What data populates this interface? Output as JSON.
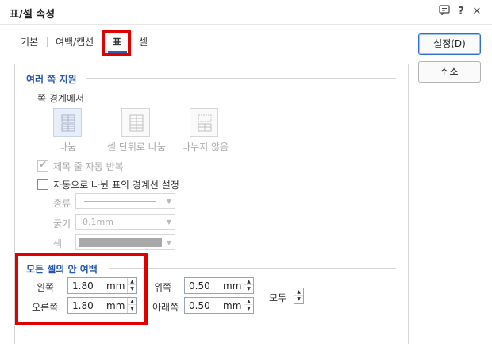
{
  "window": {
    "title": "표/셀 속성",
    "comment_icon": "comment-icon",
    "help_label": "?",
    "close_label": "✕"
  },
  "tabs": [
    {
      "label": "기본"
    },
    {
      "label": "여백/캡션"
    },
    {
      "label": "표",
      "active": true
    },
    {
      "label": "셀"
    }
  ],
  "buttons": {
    "ok": "설정(D)",
    "cancel": "취소"
  },
  "split_section": {
    "title": "여러 쪽 지원",
    "subtitle": "쪽 경계에서",
    "options": [
      {
        "label": "나눔",
        "selected": true,
        "icon": "split-table-icon"
      },
      {
        "label": "셀 단위로 나눔",
        "icon": "split-by-cell-icon"
      },
      {
        "label": "나누지 않음",
        "icon": "no-split-icon"
      }
    ],
    "repeat_title": {
      "label": "제목 줄 자동 반복",
      "checked": true,
      "disabled": true
    },
    "auto_border": {
      "label": "자동으로 나뉜 표의 경계선 설정",
      "checked": false
    }
  },
  "border_settings": {
    "type_label": "종류",
    "thickness_label": "굵기",
    "thickness_value": "0.1mm",
    "color_label": "색",
    "color_value": "#a9a9a9"
  },
  "margin_section": {
    "title": "모든 셀의 안 여백",
    "left": {
      "label": "왼쪽",
      "value": "1.80",
      "unit": "mm"
    },
    "right": {
      "label": "오른쪽",
      "value": "1.80",
      "unit": "mm"
    },
    "top": {
      "label": "위쪽",
      "value": "0.50",
      "unit": "mm"
    },
    "bottom": {
      "label": "아래쪽",
      "value": "0.50",
      "unit": "mm"
    },
    "all_label": "모두"
  },
  "colors": {
    "accent": "#2456b0",
    "highlight": "#e00000"
  }
}
